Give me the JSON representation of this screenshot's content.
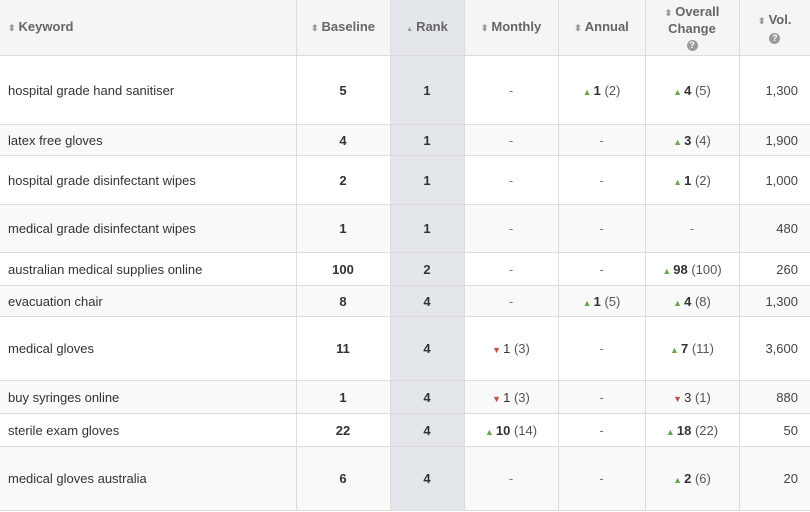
{
  "table": {
    "headers": {
      "keyword": "Keyword",
      "baseline": "Baseline",
      "rank": "Rank",
      "monthly": "Monthly",
      "annual": "Annual",
      "overall_line1": "Overall",
      "overall_line2": "Change",
      "vol": "Vol.",
      "help_glyph": "?"
    },
    "sort_glyph": "⬍",
    "sort_active_glyph": "▲",
    "colors": {
      "up": "#6aa84f",
      "down": "#c0504d",
      "header_bg": "#f5f5f5",
      "rank_bg": "#e3e7ec"
    },
    "rows": [
      {
        "keyword": "hospital grade hand sanitiser",
        "baseline": "5",
        "rank": "1",
        "monthly": {
          "dir": "none",
          "text": "-"
        },
        "annual": {
          "dir": "up",
          "val": "1",
          "prev": "(2)"
        },
        "overall": {
          "dir": "up",
          "val": "4",
          "prev": "(5)"
        },
        "vol": "1,300"
      },
      {
        "keyword": "latex free gloves",
        "baseline": "4",
        "rank": "1",
        "monthly": {
          "dir": "none",
          "text": "-"
        },
        "annual": {
          "dir": "none",
          "text": "-"
        },
        "overall": {
          "dir": "up",
          "val": "3",
          "prev": "(4)"
        },
        "vol": "1,900"
      },
      {
        "keyword": "hospital grade disinfectant wipes",
        "baseline": "2",
        "rank": "1",
        "monthly": {
          "dir": "none",
          "text": "-"
        },
        "annual": {
          "dir": "none",
          "text": "-"
        },
        "overall": {
          "dir": "up",
          "val": "1",
          "prev": "(2)"
        },
        "vol": "1,000"
      },
      {
        "keyword": "medical grade disinfectant wipes",
        "baseline": "1",
        "rank": "1",
        "monthly": {
          "dir": "none",
          "text": "-"
        },
        "annual": {
          "dir": "none",
          "text": "-"
        },
        "overall": {
          "dir": "none",
          "text": "-"
        },
        "vol": "480"
      },
      {
        "keyword": "australian medical supplies online",
        "baseline": "100",
        "rank": "2",
        "monthly": {
          "dir": "none",
          "text": "-"
        },
        "annual": {
          "dir": "none",
          "text": "-"
        },
        "overall": {
          "dir": "up",
          "val": "98",
          "prev": "(100)"
        },
        "vol": "260"
      },
      {
        "keyword": "evacuation chair",
        "baseline": "8",
        "rank": "4",
        "monthly": {
          "dir": "none",
          "text": "-"
        },
        "annual": {
          "dir": "up",
          "val": "1",
          "prev": "(5)"
        },
        "overall": {
          "dir": "up",
          "val": "4",
          "prev": "(8)"
        },
        "vol": "1,300"
      },
      {
        "keyword": "medical gloves",
        "baseline": "11",
        "rank": "4",
        "monthly": {
          "dir": "down",
          "val": "1",
          "prev": "(3)"
        },
        "annual": {
          "dir": "none",
          "text": "-"
        },
        "overall": {
          "dir": "up",
          "val": "7",
          "prev": "(11)"
        },
        "vol": "3,600"
      },
      {
        "keyword": "buy syringes online",
        "baseline": "1",
        "rank": "4",
        "monthly": {
          "dir": "down",
          "val": "1",
          "prev": "(3)"
        },
        "annual": {
          "dir": "none",
          "text": "-"
        },
        "overall": {
          "dir": "down",
          "val": "3",
          "prev": "(1)"
        },
        "vol": "880"
      },
      {
        "keyword": "sterile exam gloves",
        "baseline": "22",
        "rank": "4",
        "monthly": {
          "dir": "up",
          "val": "10",
          "prev": "(14)"
        },
        "annual": {
          "dir": "none",
          "text": "-"
        },
        "overall": {
          "dir": "up",
          "val": "18",
          "prev": "(22)"
        },
        "vol": "50"
      },
      {
        "keyword": "medical gloves australia",
        "baseline": "6",
        "rank": "4",
        "monthly": {
          "dir": "none",
          "text": "-"
        },
        "annual": {
          "dir": "none",
          "text": "-"
        },
        "overall": {
          "dir": "up",
          "val": "2",
          "prev": "(6)"
        },
        "vol": "20"
      }
    ]
  }
}
